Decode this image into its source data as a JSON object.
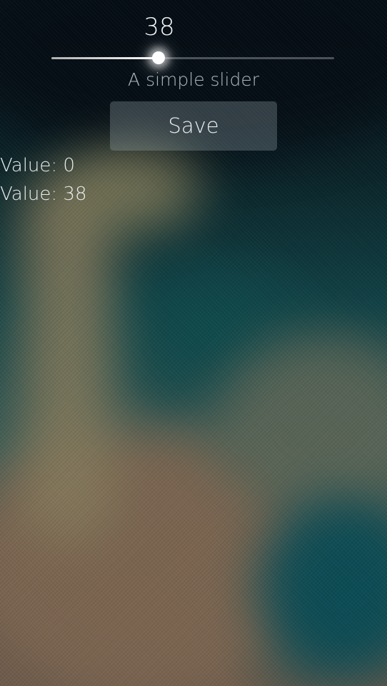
{
  "slider": {
    "value_text": "38",
    "value": 38,
    "min": 0,
    "max": 100,
    "label": "A simple slider"
  },
  "save_button": {
    "label": "Save"
  },
  "log": [
    "Value: 0",
    "Value: 38"
  ],
  "colors": {
    "text_primary": "#ffffff",
    "text_secondary": "#d6e2e6",
    "button_bg": "#aab9c3"
  }
}
